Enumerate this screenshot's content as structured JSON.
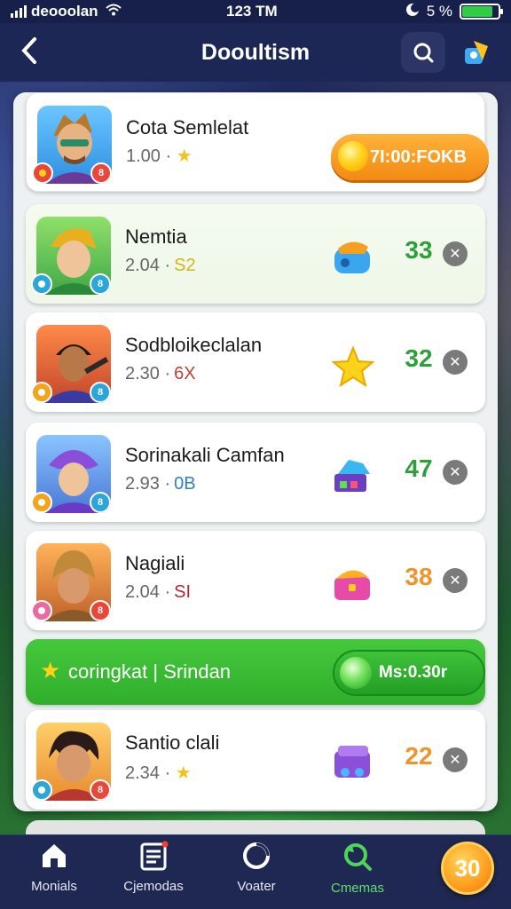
{
  "status_bar": {
    "carrier": "deooolan",
    "time": "123 TM",
    "battery_text": "5 %",
    "battery_level": 0.85
  },
  "header": {
    "title": "Dooultism",
    "back_icon": "chevron-left-icon",
    "search_icon": "search-icon",
    "fav_icon": "badge-icon"
  },
  "top_card": {
    "name": "Cota Semlelat",
    "stat": "1.00 ·",
    "button_label": "7I:00:FOKB",
    "badge_left": "",
    "badge_right": "8"
  },
  "rows": [
    {
      "name": "Nemtia",
      "stat": "2.04 ·",
      "tag": "S2",
      "tag_color": "#d4b416",
      "score": "33",
      "score_color": "#2f9f3a",
      "icon": "backpack-icon",
      "badge_right": "8"
    },
    {
      "name": "Sodbloikeclalan",
      "stat": "2.30 ·",
      "tag": "6X",
      "tag_color": "#b7433a",
      "score": "32",
      "score_color": "#2f9f3a",
      "icon": "star-icon",
      "badge_right": "8"
    },
    {
      "name": "Sorinakali Camfan",
      "stat": "2.93 ·",
      "tag": "0B",
      "tag_color": "#2e7fc9",
      "score": "47",
      "score_color": "#2f9f3a",
      "icon": "gem-icon",
      "badge_right": "8"
    },
    {
      "name": "Nagiali",
      "stat": "2.04 ·",
      "tag": "SI",
      "tag_color": "#b3282e",
      "score": "38",
      "score_color": "#f0932b",
      "icon": "chest-icon",
      "badge_right": "8"
    }
  ],
  "banner": {
    "text": "coringkat | Srindan",
    "button_label": "Ms:0.30r"
  },
  "last_row": {
    "name": "Santio clali",
    "stat": "2.34 ·",
    "score": "22",
    "score_color": "#f0932b",
    "icon": "purple-box-icon",
    "badge_right": "8"
  },
  "nav": {
    "items": [
      {
        "label": "Monials",
        "icon": "home-icon"
      },
      {
        "label": "Cjemodas",
        "icon": "list-icon"
      },
      {
        "label": "Voater",
        "icon": "circle-icon"
      },
      {
        "label": "Cmemas",
        "icon": "refresh-search-icon"
      }
    ],
    "coin_count": "30"
  },
  "colors": {
    "accent_green": "#2fae2c",
    "accent_orange": "#f28a12",
    "header_bg": "#1d2756"
  }
}
